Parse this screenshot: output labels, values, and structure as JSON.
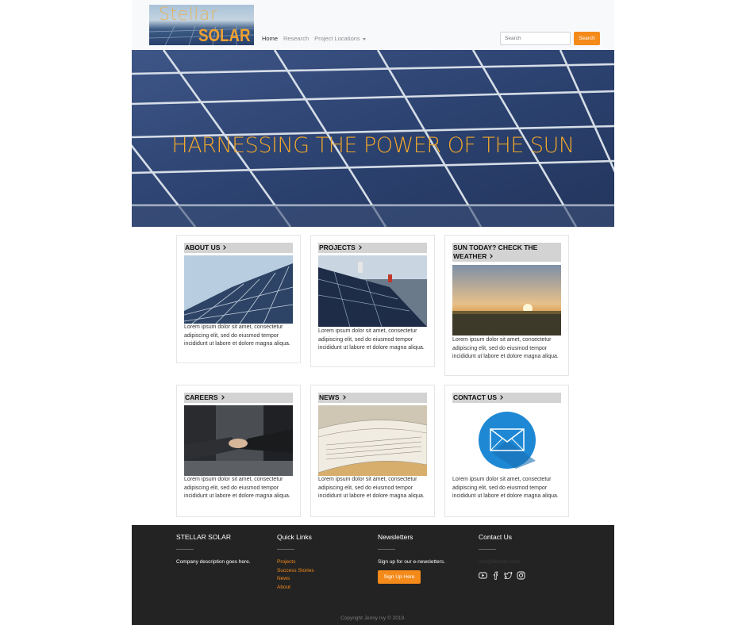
{
  "brand": {
    "logo_word_1": "Stellar",
    "logo_word_2": "SOLAR"
  },
  "nav": {
    "items": [
      {
        "label": "Home",
        "active": true
      },
      {
        "label": "Research",
        "active": false
      },
      {
        "label": "Project Locations",
        "active": false,
        "dropdown": true
      }
    ],
    "search_placeholder": "Search",
    "search_button": "Search"
  },
  "hero": {
    "title": "HARNESSING THE POWER OF THE SUN"
  },
  "cards": [
    {
      "title": "ABOUT US",
      "image": "solar-panel-closeup-photo",
      "text": "Lorem ipsum dolor sit amet, consectetur adipiscing elit, sed do eiusmod tempor incididunt ut labore et dolore magna aliqua."
    },
    {
      "title": "PROJECTS",
      "image": "workers-installing-panels-photo",
      "text": "Lorem ipsum dolor sit amet, consectetur adipiscing elit, sed do eiusmod tempor incididunt ut labore et dolore magna aliqua."
    },
    {
      "title": "SUN TODAY? CHECK THE WEATHER",
      "image": "sunset-field-photo",
      "text": "Lorem ipsum dolor sit amet, consectetur adipiscing elit, sed do eiusmod tempor incididunt ut labore et dolore magna aliqua."
    },
    {
      "title": "CAREERS",
      "image": "handshake-photo",
      "text": "Lorem ipsum dolor sit amet, consectetur adipiscing elit, sed do eiusmod tempor incididunt ut labore et dolore magna aliqua."
    },
    {
      "title": "NEWS",
      "image": "newspapers-photo",
      "text": "Lorem ipsum dolor sit amet, consectetur adipiscing elit, sed do eiusmod tempor incididunt ut labore et dolore magna aliqua."
    },
    {
      "title": "CONTACT US",
      "image": "envelope-icon",
      "text": "Lorem ipsum dolor sit amet, consectetur adipiscing elit, sed do eiusmod tempor incididunt ut labore et dolore magna aliqua."
    }
  ],
  "footer": {
    "company": {
      "heading": "STELLAR SOLAR",
      "text": "Company description goes here."
    },
    "quick_links": {
      "heading": "Quick Links",
      "links": [
        "Projects",
        "Success Stories",
        "News",
        "About"
      ]
    },
    "newsletters": {
      "heading": "Newsletters",
      "text": "Sign up for our e-newsletters.",
      "button": "Sign Up Here"
    },
    "contact": {
      "heading": "Contact Us",
      "email": "info@domain.com",
      "icons": [
        "youtube-icon",
        "facebook-icon",
        "twitter-icon",
        "instagram-icon"
      ]
    },
    "copyright": "Copyright Jenny Ivy © 2019."
  },
  "colors": {
    "accent": "#f48a1a",
    "navbar_bg": "#f8f9fa",
    "footer_bg": "#232323",
    "hero_text": "#f0a830",
    "card_title_bg": "#d3d3d3"
  }
}
